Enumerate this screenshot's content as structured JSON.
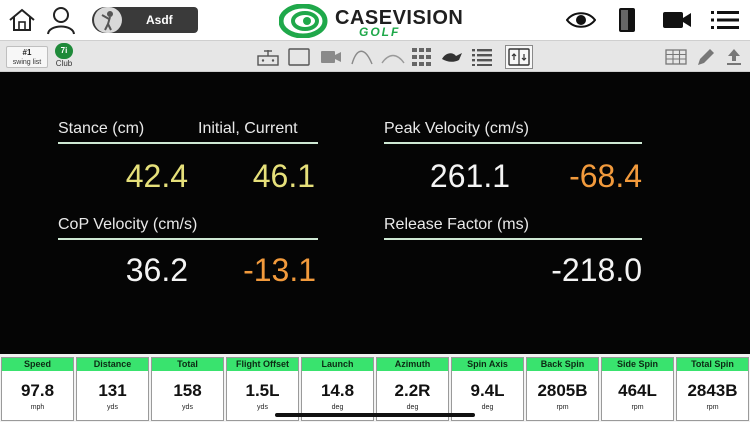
{
  "header": {
    "user_name": "Asdf",
    "logo_word": "CASEVISION",
    "logo_sub": "GOLF"
  },
  "toolbar": {
    "swing_number": "#1",
    "swing_list_label": "swing list",
    "club_badge": "7i",
    "club_label": "Club"
  },
  "metrics": {
    "stance": {
      "label": "Stance (cm)",
      "sub_label": "Initial, Current",
      "initial": "42.4",
      "current": "46.1"
    },
    "peak_velocity": {
      "label": "Peak Velocity (cm/s)",
      "value1": "261.1",
      "value2": "-68.4"
    },
    "cop_velocity": {
      "label": "CoP Velocity (cm/s)",
      "value1": "36.2",
      "value2": "-13.1"
    },
    "release_factor": {
      "label": "Release Factor (ms)",
      "value": "-218.0"
    }
  },
  "colors": {
    "accent_green": "#39e36e",
    "value_yellow": "#e6e07a",
    "value_orange": "#f29a3c",
    "value_white": "#f4f4f4"
  },
  "stats": [
    {
      "label": "Speed",
      "value": "97.8",
      "unit": "mph"
    },
    {
      "label": "Distance",
      "value": "131",
      "unit": "yds"
    },
    {
      "label": "Total",
      "value": "158",
      "unit": "yds"
    },
    {
      "label": "Flight Offset",
      "value": "1.5L",
      "unit": "yds"
    },
    {
      "label": "Launch",
      "value": "14.8",
      "unit": "deg"
    },
    {
      "label": "Azimuth",
      "value": "2.2R",
      "unit": "deg"
    },
    {
      "label": "Spin Axis",
      "value": "9.4L",
      "unit": "deg"
    },
    {
      "label": "Back Spin",
      "value": "2805B",
      "unit": "rpm"
    },
    {
      "label": "Side Spin",
      "value": "464L",
      "unit": "rpm"
    },
    {
      "label": "Total Spin",
      "value": "2843B",
      "unit": "rpm"
    }
  ],
  "icons": {
    "top_left": [
      "home-icon",
      "user-icon",
      "golfer-avatar-icon"
    ],
    "top_right": [
      "eye-icon",
      "phone-icon",
      "video-icon",
      "menu-icon"
    ],
    "toolbar": [
      "device-icon",
      "square-icon",
      "camera-icon",
      "arc-icon",
      "flat-arc-icon",
      "grid-icon",
      "club-swoosh-icon",
      "list-icon",
      "balance-board-icon",
      "table-icon",
      "pencil-icon",
      "share-icon"
    ]
  }
}
